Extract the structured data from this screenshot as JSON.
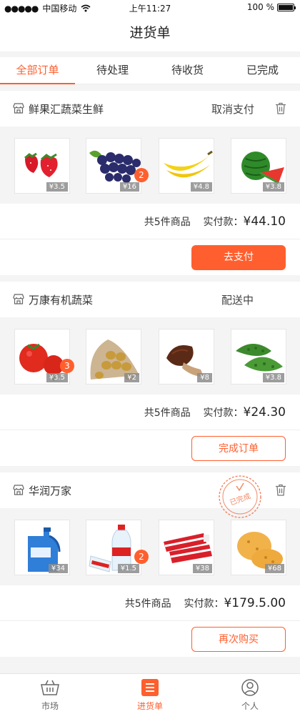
{
  "status_bar": {
    "signal": "●●●●●",
    "carrier": "中国移动",
    "time": "上午11:27",
    "battery": "100 %",
    "battery_level": 1.0
  },
  "page_title": "进货单",
  "tabs": [
    {
      "label": "全部订单",
      "active": true
    },
    {
      "label": "待处理",
      "active": false
    },
    {
      "label": "待收货",
      "active": false
    },
    {
      "label": "已完成",
      "active": false
    }
  ],
  "orders": [
    {
      "shop": "鲜果汇蔬菜生鲜",
      "status": "取消支付",
      "items": [
        {
          "name": "strawberry",
          "price": "¥3.5"
        },
        {
          "name": "grapes",
          "price": "¥16",
          "badge": "2"
        },
        {
          "name": "banana",
          "price": "¥4.8"
        },
        {
          "name": "watermelon",
          "price": "¥3.8"
        }
      ],
      "count_text": "共5件商品",
      "paid_label": "实付款：",
      "amount": "¥44.10",
      "button": "去支付"
    },
    {
      "shop": "万康有机蔬菜",
      "status": "配送中",
      "items": [
        {
          "name": "tomato",
          "price": "¥3.5",
          "badge": "3"
        },
        {
          "name": "potato",
          "price": "¥2"
        },
        {
          "name": "mushroom",
          "price": "¥8"
        },
        {
          "name": "bitter-melon",
          "price": "¥3.8"
        }
      ],
      "count_text": "共5件商品",
      "paid_label": "实付款：",
      "amount": "¥24.30",
      "button": "完成订单"
    },
    {
      "shop": "华润万家",
      "status": "已完成",
      "items": [
        {
          "name": "detergent",
          "price": "¥34"
        },
        {
          "name": "water-bottle",
          "price": "¥1.5",
          "badge": "2"
        },
        {
          "name": "toothpaste",
          "price": "¥38"
        },
        {
          "name": "pastry",
          "price": "¥68"
        }
      ],
      "count_text": "共5件商品",
      "paid_label": "实付款：",
      "amount": "¥179.5.00",
      "button": "再次购买"
    }
  ],
  "bottom_nav": [
    {
      "label": "市场",
      "icon": "basket-icon",
      "active": false
    },
    {
      "label": "进货单",
      "icon": "list-icon",
      "active": true
    },
    {
      "label": "个人",
      "icon": "user-icon",
      "active": false
    }
  ],
  "colors": {
    "accent": "#ff5f2e",
    "background": "#f4f4f4"
  }
}
